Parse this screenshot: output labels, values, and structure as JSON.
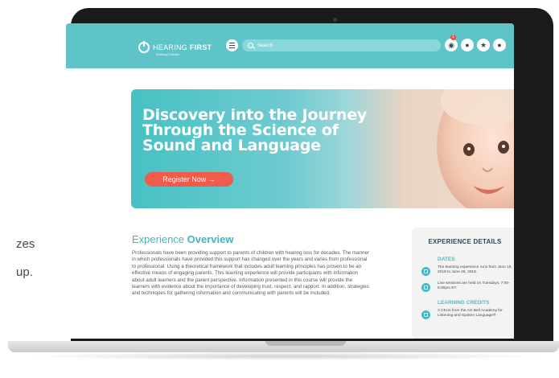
{
  "background": {
    "line1": "zes",
    "line2": "up."
  },
  "header": {
    "logo_text_regular": "HEARING",
    "logo_text_bold": "FIRST",
    "logo_subtitle": "Realizing Potential",
    "search_placeholder": "Search",
    "notification_count": "1",
    "icons": [
      "globe-icon",
      "chat-icon",
      "star-icon",
      "user-icon"
    ]
  },
  "hero": {
    "title_line1": "Discovery into the Journey",
    "title_line2": "Through the Science of",
    "title_line3": "Sound and Language",
    "button_label": "Register Now →"
  },
  "overview": {
    "title_regular": "Experience",
    "title_bold": "Overview",
    "body": "Professionals have been providing support to parents of children with hearing loss for decades. The manner in which professionals have provided this support has changed over the years and varies from professional to professional. Using a theoretical framework that includes adult learning principles has proven to be an effective means of engaging parents. This learning experience will provide participants with information about adult learners and the parent perspective. Information presented in this course will provide the learners with evidence about the importance of developing trust, respect, and rapport. In addition, strategies and techniques for gathering information and communicating with parents will be included."
  },
  "details": {
    "title": "EXPERIENCE DETAILS",
    "dates_heading": "DATES",
    "dates_item1": "The learning experience runs from June 19, 2018 to June 26, 2018.",
    "dates_item2": "Live sessions are held on Tuesdays, 7:00-8:30pm ET.",
    "credits_heading": "LEARNING CREDITS",
    "credits_item1": "3 CEUs from the AG Bell Academy for Listening and Spoken Language®"
  },
  "colors": {
    "header": "#5ec4c8",
    "accent": "#3fb6c0",
    "button": "#ef5c4c"
  }
}
